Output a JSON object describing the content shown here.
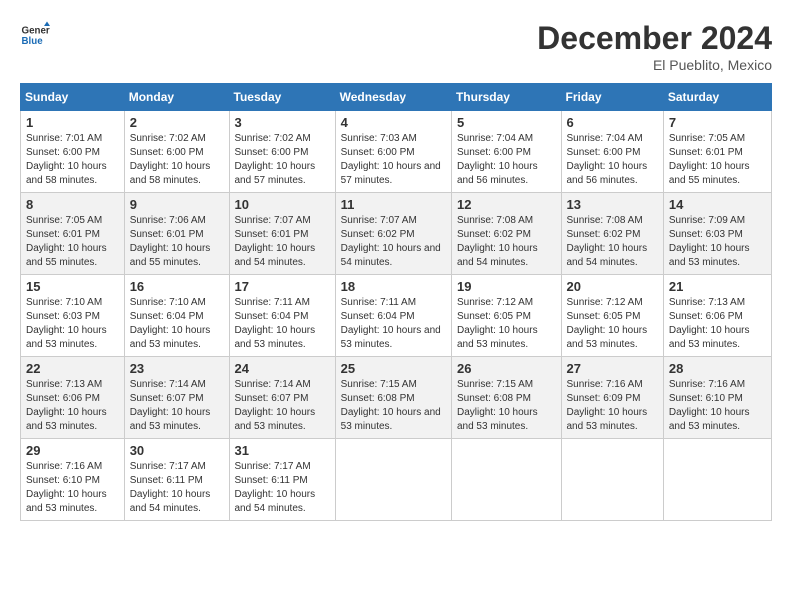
{
  "logo": {
    "line1": "General",
    "line2": "Blue"
  },
  "title": {
    "month": "December 2024",
    "location": "El Pueblito, Mexico"
  },
  "headers": [
    "Sunday",
    "Monday",
    "Tuesday",
    "Wednesday",
    "Thursday",
    "Friday",
    "Saturday"
  ],
  "weeks": [
    [
      {
        "day": "1",
        "sunrise": "7:01 AM",
        "sunset": "6:00 PM",
        "daylight": "10 hours and 58 minutes."
      },
      {
        "day": "2",
        "sunrise": "7:02 AM",
        "sunset": "6:00 PM",
        "daylight": "10 hours and 58 minutes."
      },
      {
        "day": "3",
        "sunrise": "7:02 AM",
        "sunset": "6:00 PM",
        "daylight": "10 hours and 57 minutes."
      },
      {
        "day": "4",
        "sunrise": "7:03 AM",
        "sunset": "6:00 PM",
        "daylight": "10 hours and 57 minutes."
      },
      {
        "day": "5",
        "sunrise": "7:04 AM",
        "sunset": "6:00 PM",
        "daylight": "10 hours and 56 minutes."
      },
      {
        "day": "6",
        "sunrise": "7:04 AM",
        "sunset": "6:00 PM",
        "daylight": "10 hours and 56 minutes."
      },
      {
        "day": "7",
        "sunrise": "7:05 AM",
        "sunset": "6:01 PM",
        "daylight": "10 hours and 55 minutes."
      }
    ],
    [
      {
        "day": "8",
        "sunrise": "7:05 AM",
        "sunset": "6:01 PM",
        "daylight": "10 hours and 55 minutes."
      },
      {
        "day": "9",
        "sunrise": "7:06 AM",
        "sunset": "6:01 PM",
        "daylight": "10 hours and 55 minutes."
      },
      {
        "day": "10",
        "sunrise": "7:07 AM",
        "sunset": "6:01 PM",
        "daylight": "10 hours and 54 minutes."
      },
      {
        "day": "11",
        "sunrise": "7:07 AM",
        "sunset": "6:02 PM",
        "daylight": "10 hours and 54 minutes."
      },
      {
        "day": "12",
        "sunrise": "7:08 AM",
        "sunset": "6:02 PM",
        "daylight": "10 hours and 54 minutes."
      },
      {
        "day": "13",
        "sunrise": "7:08 AM",
        "sunset": "6:02 PM",
        "daylight": "10 hours and 54 minutes."
      },
      {
        "day": "14",
        "sunrise": "7:09 AM",
        "sunset": "6:03 PM",
        "daylight": "10 hours and 53 minutes."
      }
    ],
    [
      {
        "day": "15",
        "sunrise": "7:10 AM",
        "sunset": "6:03 PM",
        "daylight": "10 hours and 53 minutes."
      },
      {
        "day": "16",
        "sunrise": "7:10 AM",
        "sunset": "6:04 PM",
        "daylight": "10 hours and 53 minutes."
      },
      {
        "day": "17",
        "sunrise": "7:11 AM",
        "sunset": "6:04 PM",
        "daylight": "10 hours and 53 minutes."
      },
      {
        "day": "18",
        "sunrise": "7:11 AM",
        "sunset": "6:04 PM",
        "daylight": "10 hours and 53 minutes."
      },
      {
        "day": "19",
        "sunrise": "7:12 AM",
        "sunset": "6:05 PM",
        "daylight": "10 hours and 53 minutes."
      },
      {
        "day": "20",
        "sunrise": "7:12 AM",
        "sunset": "6:05 PM",
        "daylight": "10 hours and 53 minutes."
      },
      {
        "day": "21",
        "sunrise": "7:13 AM",
        "sunset": "6:06 PM",
        "daylight": "10 hours and 53 minutes."
      }
    ],
    [
      {
        "day": "22",
        "sunrise": "7:13 AM",
        "sunset": "6:06 PM",
        "daylight": "10 hours and 53 minutes."
      },
      {
        "day": "23",
        "sunrise": "7:14 AM",
        "sunset": "6:07 PM",
        "daylight": "10 hours and 53 minutes."
      },
      {
        "day": "24",
        "sunrise": "7:14 AM",
        "sunset": "6:07 PM",
        "daylight": "10 hours and 53 minutes."
      },
      {
        "day": "25",
        "sunrise": "7:15 AM",
        "sunset": "6:08 PM",
        "daylight": "10 hours and 53 minutes."
      },
      {
        "day": "26",
        "sunrise": "7:15 AM",
        "sunset": "6:08 PM",
        "daylight": "10 hours and 53 minutes."
      },
      {
        "day": "27",
        "sunrise": "7:16 AM",
        "sunset": "6:09 PM",
        "daylight": "10 hours and 53 minutes."
      },
      {
        "day": "28",
        "sunrise": "7:16 AM",
        "sunset": "6:10 PM",
        "daylight": "10 hours and 53 minutes."
      }
    ],
    [
      {
        "day": "29",
        "sunrise": "7:16 AM",
        "sunset": "6:10 PM",
        "daylight": "10 hours and 53 minutes."
      },
      {
        "day": "30",
        "sunrise": "7:17 AM",
        "sunset": "6:11 PM",
        "daylight": "10 hours and 54 minutes."
      },
      {
        "day": "31",
        "sunrise": "7:17 AM",
        "sunset": "6:11 PM",
        "daylight": "10 hours and 54 minutes."
      },
      null,
      null,
      null,
      null
    ]
  ]
}
